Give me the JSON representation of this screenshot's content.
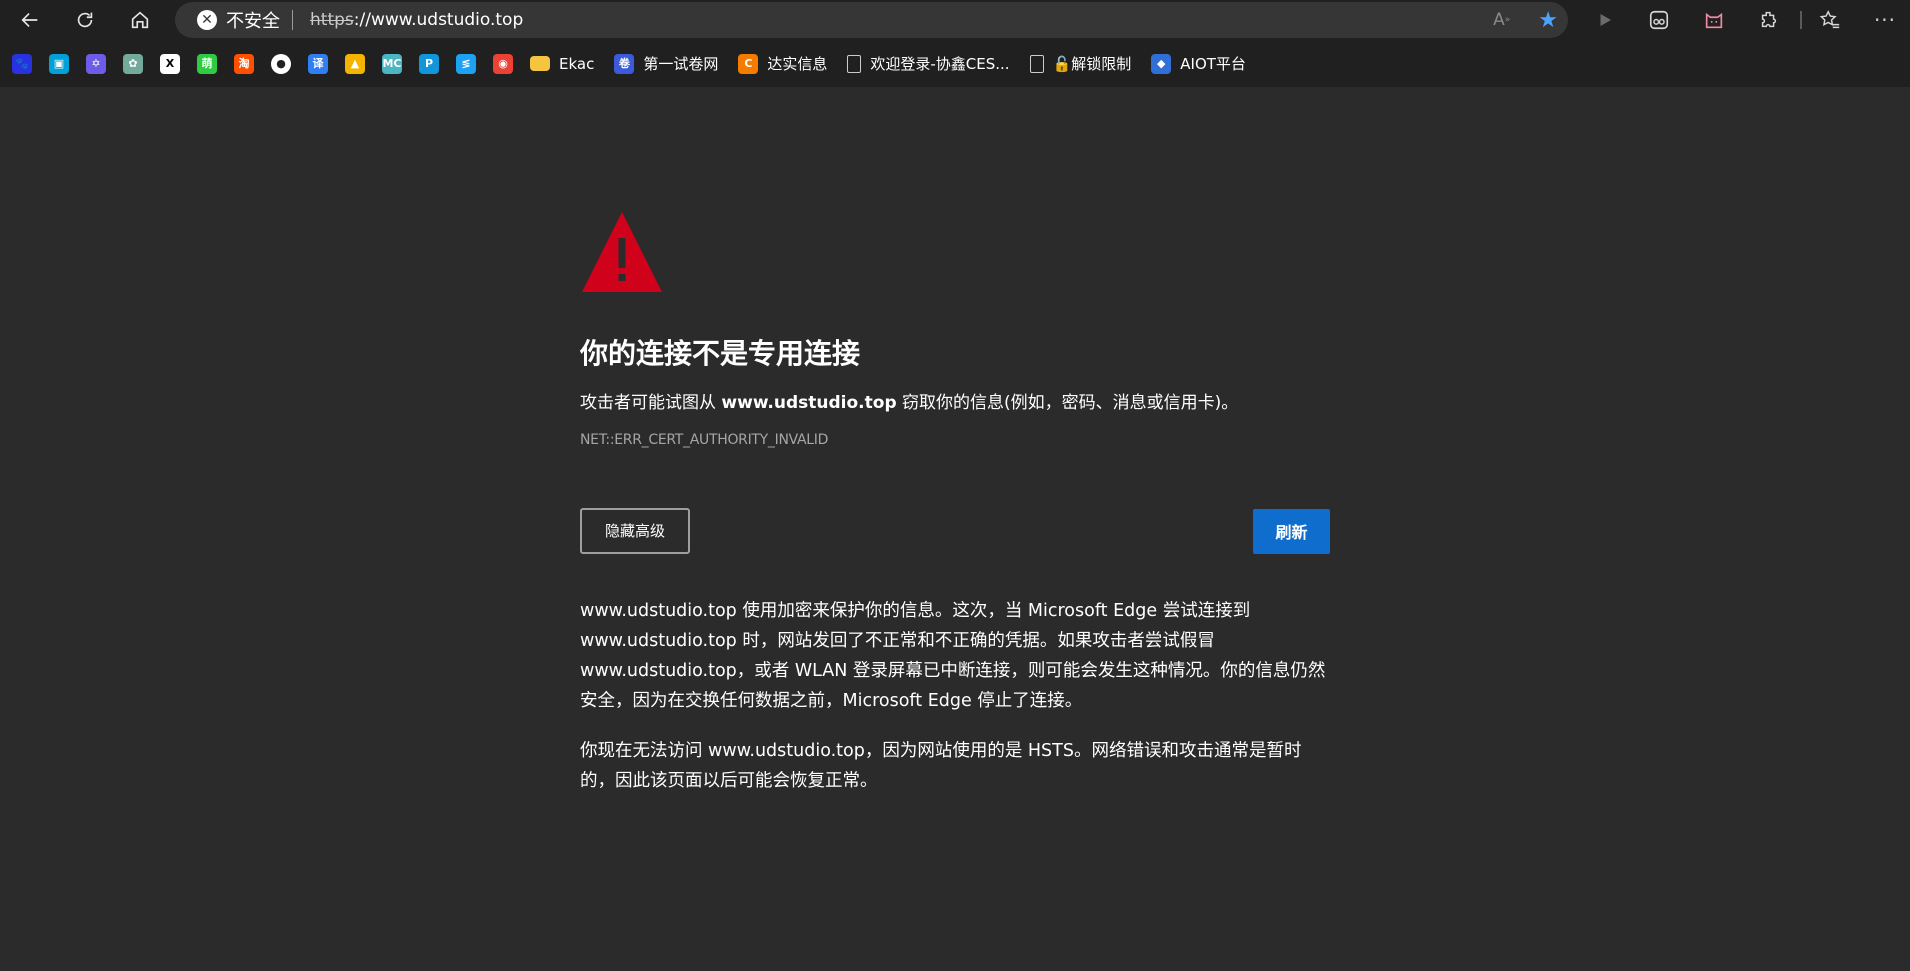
{
  "browser": {
    "security_label": "不安全",
    "url_scheme": "https",
    "url_rest": "://www.udstudio.top"
  },
  "bookmarks": [
    {
      "icon": "baidu-icon",
      "label": "",
      "color": "#2932e1"
    },
    {
      "icon": "bilibili-icon",
      "label": "",
      "color": "#00a1d6"
    },
    {
      "icon": "star-of-david-icon",
      "label": "",
      "color": "#6c5ce7"
    },
    {
      "icon": "chatgpt-icon",
      "label": "",
      "color": "#74aa9c"
    },
    {
      "icon": "x-icon",
      "label": "",
      "color": "#000000"
    },
    {
      "icon": "meng-icon",
      "label": "",
      "color": "#2ecc40"
    },
    {
      "icon": "taobao-icon",
      "label": "",
      "color": "#ff5000"
    },
    {
      "icon": "github-icon",
      "label": "",
      "color": "#ffffff"
    },
    {
      "icon": "translate-icon",
      "label": "",
      "color": "#2f7ff3"
    },
    {
      "icon": "google-drive-icon",
      "label": "",
      "color": "#f4b400"
    },
    {
      "icon": "mc-icon",
      "label": "",
      "color": "#4bb5c1"
    },
    {
      "icon": "p-icon",
      "label": "",
      "color": "#1296db"
    },
    {
      "icon": "arrow-s-icon",
      "label": "",
      "color": "#1da1f2"
    },
    {
      "icon": "chrome-icon",
      "label": "",
      "color": "#ea4335"
    },
    {
      "icon": "folder-icon",
      "label": "Ekac",
      "color": "#f5c542"
    },
    {
      "icon": "juanwang-icon",
      "label": "第一试卷网",
      "color": "#3b5bdb"
    },
    {
      "icon": "c-orange-icon",
      "label": "达实信息",
      "color": "#f57c00"
    },
    {
      "icon": "page-icon",
      "label": "欢迎登录-协鑫CES...",
      "color": "#cccccc"
    },
    {
      "icon": "page-icon",
      "label": "🔓解锁限制",
      "color": "#cccccc"
    },
    {
      "icon": "aiot-icon",
      "label": "AIOT平台",
      "color": "#2f6fd6"
    }
  ],
  "page": {
    "title": "你的连接不是专用连接",
    "desc_before": "攻击者可能试图从 ",
    "desc_host": "www.udstudio.top",
    "desc_after": " 窃取你的信息(例如，密码、消息或信用卡)。",
    "error_code": "NET::ERR_CERT_AUTHORITY_INVALID",
    "hide_advanced_label": "隐藏高级",
    "refresh_label": "刷新",
    "advanced_paragraph_1": "www.udstudio.top 使用加密来保护你的信息。这次，当 Microsoft Edge 尝试连接到 www.udstudio.top 时，网站发回了不正常和不正确的凭据。如果攻击者尝试假冒 www.udstudio.top，或者 WLAN 登录屏幕已中断连接，则可能会发生这种情况。你的信息仍然安全，因为在交换任何数据之前，Microsoft Edge 停止了连接。",
    "advanced_paragraph_2": "你现在无法访问 www.udstudio.top，因为网站使用的是 HSTS。网络错误和攻击通常是暂时的，因此该页面以后可能会恢复正常。"
  },
  "colors": {
    "warning_red": "#d0021b",
    "refresh_blue": "#0f6ecd",
    "page_bg": "#2b2b2b",
    "chrome_bg": "#202020"
  }
}
